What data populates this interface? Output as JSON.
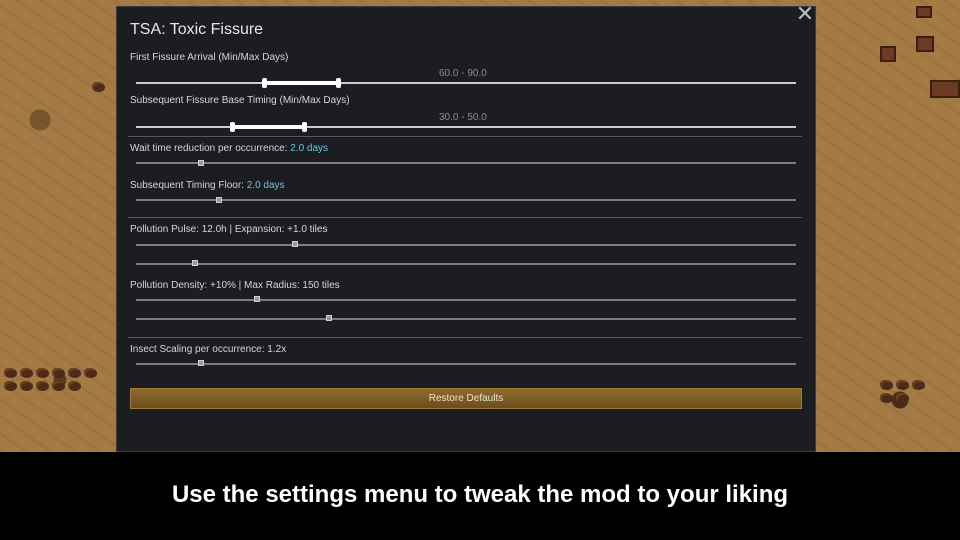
{
  "dialog": {
    "title": "TSA: Toxic Fissure",
    "close_icon": "close-icon"
  },
  "settings": {
    "first_arrival": {
      "label": "First Fissure Arrival (Min/Max Days)",
      "range_text": "60.0 - 90.0",
      "min": 60.0,
      "max": 90.0
    },
    "subsequent_timing": {
      "label": "Subsequent Fissure Base Timing (Min/Max Days)",
      "range_text": "30.0 - 50.0",
      "min": 30.0,
      "max": 50.0
    },
    "wait_reduction": {
      "label": "Wait time reduction per occurrence: ",
      "value_text": "2.0 days",
      "value": 2.0
    },
    "timing_floor": {
      "label": "Subsequent Timing Floor: ",
      "value_text": "2.0 days",
      "value": 2.0
    },
    "pollution_pulse": {
      "label": "Pollution Pulse: 12.0h | Expansion: +1.0 tiles",
      "pulse_hours": 12.0,
      "expansion_tiles": 1.0
    },
    "pollution_density": {
      "label": "Pollution Density: +10% | Max Radius: 150 tiles",
      "density_percent": 10,
      "max_radius_tiles": 150
    },
    "insect_scaling": {
      "label": "Insect Scaling per occurrence: 1.2x",
      "value": 1.2
    }
  },
  "buttons": {
    "restore_defaults": "Restore Defaults"
  },
  "caption": "Use the settings menu to tweak the mod to your liking",
  "colors": {
    "dialog_bg": "#1b1d21",
    "highlight": "#66c6dc",
    "button": "#7a5a24"
  }
}
